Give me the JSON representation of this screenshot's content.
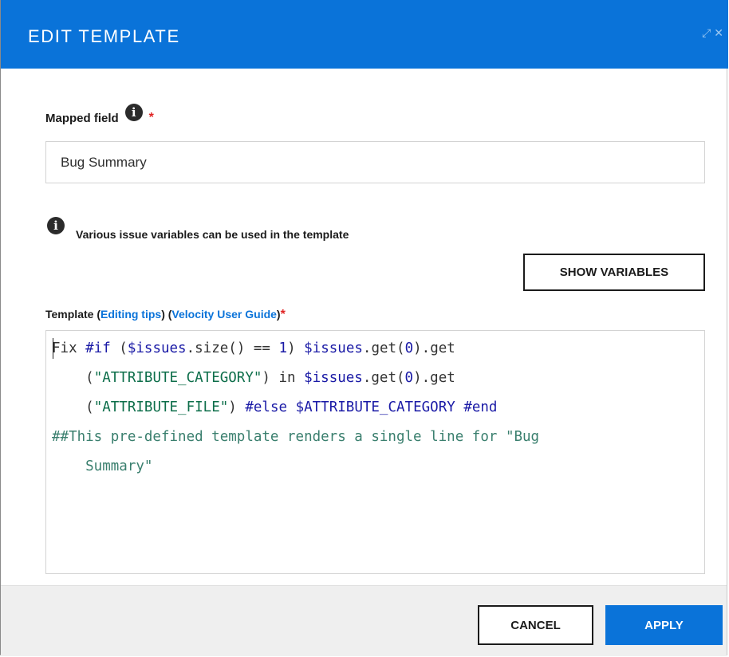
{
  "header": {
    "title": "EDIT TEMPLATE",
    "icons": [
      "expand-icon",
      "close-icon"
    ]
  },
  "mapped_field": {
    "label": "Mapped field",
    "info_glyph": "i",
    "required_mark": "*",
    "value": "Bug Summary"
  },
  "hint": {
    "info_glyph": "i",
    "text": "Various issue variables can be used in the template"
  },
  "show_variables_label": "SHOW VARIABLES",
  "template": {
    "label_prefix": "Template (",
    "editing_tips": "Editing tips",
    "between": ") (",
    "velocity_guide": "Velocity User Guide",
    "label_suffix": ")",
    "required_mark": "*"
  },
  "code": {
    "line1": {
      "t1": "Fix ",
      "t2": "#if",
      "t3": " (",
      "t4": "$issues",
      "t5": ".size() == ",
      "t6": "1",
      "t7": ") ",
      "t8": "$issues",
      "t9": ".get(",
      "t10": "0",
      "t11": ").get"
    },
    "line2": {
      "t1": "    (",
      "t2": "\"ATTRIBUTE_CATEGORY\"",
      "t3": ") in ",
      "t4": "$issues",
      "t5": ".get(",
      "t6": "0",
      "t7": ").get"
    },
    "line3": {
      "t1": "    (",
      "t2": "\"ATTRIBUTE_FILE\"",
      "t3": ") ",
      "t4": "#else",
      "t5": " ",
      "t6": "$ATTRIBUTE_CATEGORY",
      "t7": " ",
      "t8": "#end"
    },
    "line4": "##This pre-defined template renders a single line for \"Bug",
    "line5": "    Summary\""
  },
  "footer": {
    "cancel_label": "CANCEL",
    "apply_label": "APPLY"
  },
  "colors": {
    "accent": "#0a73d9",
    "required": "#e02424"
  }
}
